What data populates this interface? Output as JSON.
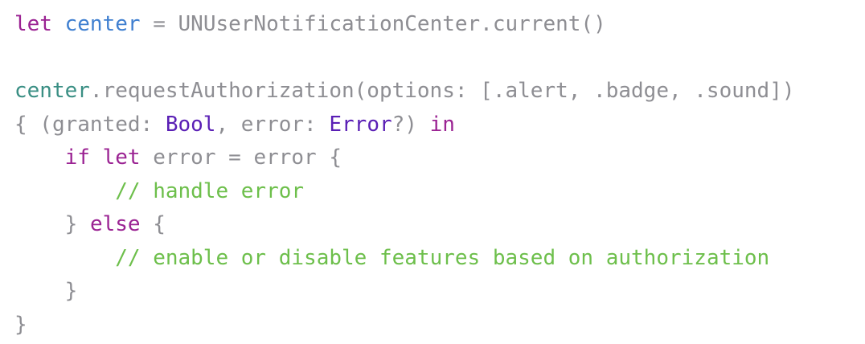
{
  "code": {
    "line1": {
      "kw_let": "let",
      "sp1": " ",
      "var_center": "center",
      "rest": " = UNUserNotificationCenter.current()"
    },
    "line3": {
      "ref_center": "center",
      "rest": ".requestAuthorization(options: [.alert, .badge, .sound])"
    },
    "line4": {
      "open": "{ (granted: ",
      "type_bool": "Bool",
      "mid": ", error: ",
      "type_error": "Error",
      "tail": "?) ",
      "kw_in": "in"
    },
    "line5": {
      "indent": "    ",
      "kw_if": "if",
      "sp1": " ",
      "kw_let": "let",
      "rest": " error = error {"
    },
    "line6": {
      "indent": "        ",
      "comment": "// handle error"
    },
    "line7": {
      "indent": "    ",
      "brace": "} ",
      "kw_else": "else",
      "rest": " {"
    },
    "line8": {
      "indent": "        ",
      "comment": "// enable or disable features based on authorization"
    },
    "line9": {
      "indent": "    ",
      "brace": "}"
    },
    "line10": {
      "brace": "}"
    }
  },
  "colors": {
    "keyword": "#9b2393",
    "declared_identifier": "#3f7fd0",
    "referenced_identifier": "#3a8f84",
    "type": "#5a1fb5",
    "comment": "#6dbf4b",
    "plain": "#8e8e93",
    "background": "#ffffff"
  }
}
